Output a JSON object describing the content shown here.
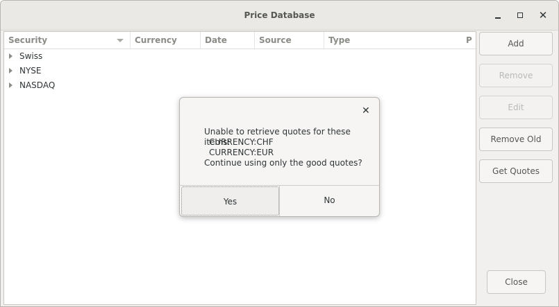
{
  "window": {
    "title": "Price Database"
  },
  "table": {
    "columns": [
      "Security",
      "Currency",
      "Date",
      "Source",
      "Type",
      "P"
    ],
    "rows": [
      {
        "label": "Swiss"
      },
      {
        "label": "NYSE"
      },
      {
        "label": "NASDAQ"
      }
    ]
  },
  "sidebar": {
    "buttons": [
      {
        "label": "Add",
        "enabled": true
      },
      {
        "label": "Remove",
        "enabled": false
      },
      {
        "label": "Edit",
        "enabled": false
      },
      {
        "label": "Remove Old",
        "enabled": true
      },
      {
        "label": "Get Quotes",
        "enabled": true
      }
    ],
    "close_label": "Close"
  },
  "dialog": {
    "close_glyph": "✕",
    "message_lines": [
      "Unable to retrieve quotes for these items:",
      "CURRENCY:CHF",
      "CURRENCY:EUR",
      "Continue using only the good quotes?"
    ],
    "yes_label": "Yes",
    "no_label": "No"
  }
}
